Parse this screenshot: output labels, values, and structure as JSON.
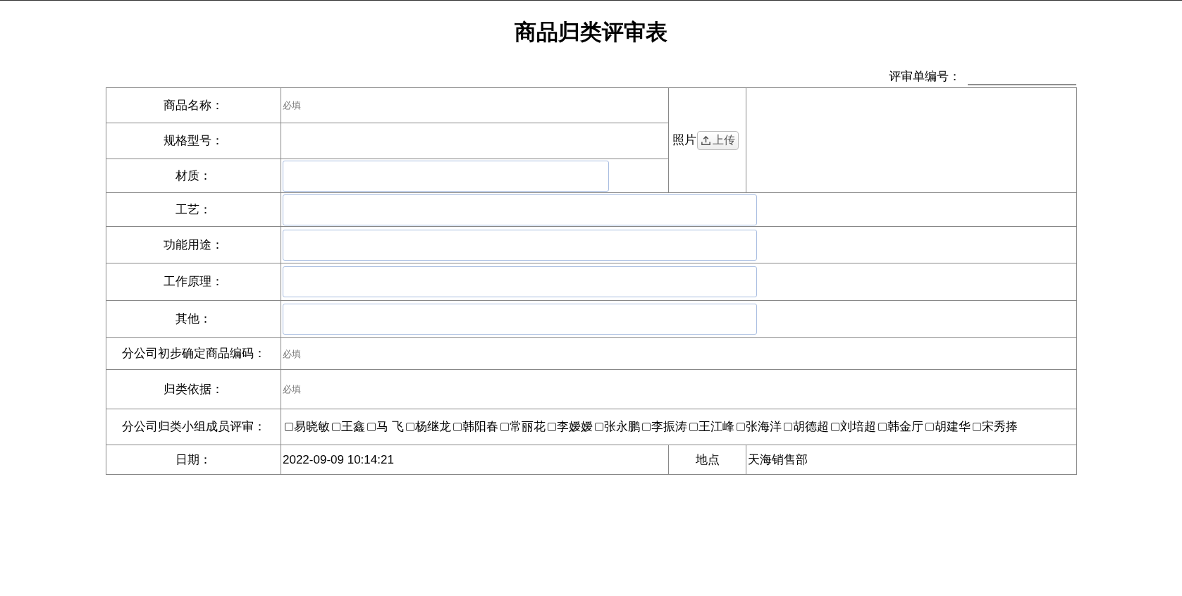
{
  "title": "商品归类评审表",
  "review_no": {
    "label": "评审单编号："
  },
  "rows": [
    {
      "label": "商品名称：",
      "field": {
        "kind": "plain",
        "placeholder": "必填"
      }
    },
    {
      "label": "规格型号：",
      "field": {
        "kind": "plain"
      }
    },
    {
      "label": "材质：",
      "field": {
        "kind": "boxed"
      }
    },
    {
      "label": "工艺：",
      "field": {
        "kind": "boxed"
      }
    },
    {
      "label": "功能用途：",
      "field": {
        "kind": "boxed"
      }
    },
    {
      "label": "工作原理：",
      "field": {
        "kind": "boxed"
      }
    },
    {
      "label": "其他：",
      "field": {
        "kind": "boxed"
      }
    },
    {
      "label": "分公司初步确定商品编码：",
      "field": {
        "kind": "plain",
        "placeholder": "必填"
      }
    },
    {
      "label": "归类依据：",
      "field": {
        "kind": "plain",
        "placeholder": "必填"
      }
    }
  ],
  "photo": {
    "label": "照片",
    "button": "上传"
  },
  "members": {
    "label": "分公司归类小组成员评审：",
    "items": [
      {
        "name": "易晓敏",
        "checked": false
      },
      {
        "name": "王鑫",
        "checked": false
      },
      {
        "name": "马 飞",
        "checked": false
      },
      {
        "name": "杨继龙",
        "checked": false
      },
      {
        "name": "韩阳春",
        "checked": false
      },
      {
        "name": "常丽花",
        "checked": false
      },
      {
        "name": "李嫒嫒",
        "checked": false
      },
      {
        "name": "张永鹏",
        "checked": false
      },
      {
        "name": "李振涛",
        "checked": false
      },
      {
        "name": "王江峰",
        "checked": false
      },
      {
        "name": "张海洋",
        "checked": false
      },
      {
        "name": "胡德超",
        "checked": false
      },
      {
        "name": "刘培超",
        "checked": false
      },
      {
        "name": "韩金厅",
        "checked": false
      },
      {
        "name": "胡建华",
        "checked": false
      },
      {
        "name": "宋秀捧",
        "checked": false
      }
    ]
  },
  "date": {
    "label": "日期：",
    "value": "2022-09-09 10:14:21"
  },
  "location": {
    "label": "地点",
    "value": "天海销售部"
  }
}
